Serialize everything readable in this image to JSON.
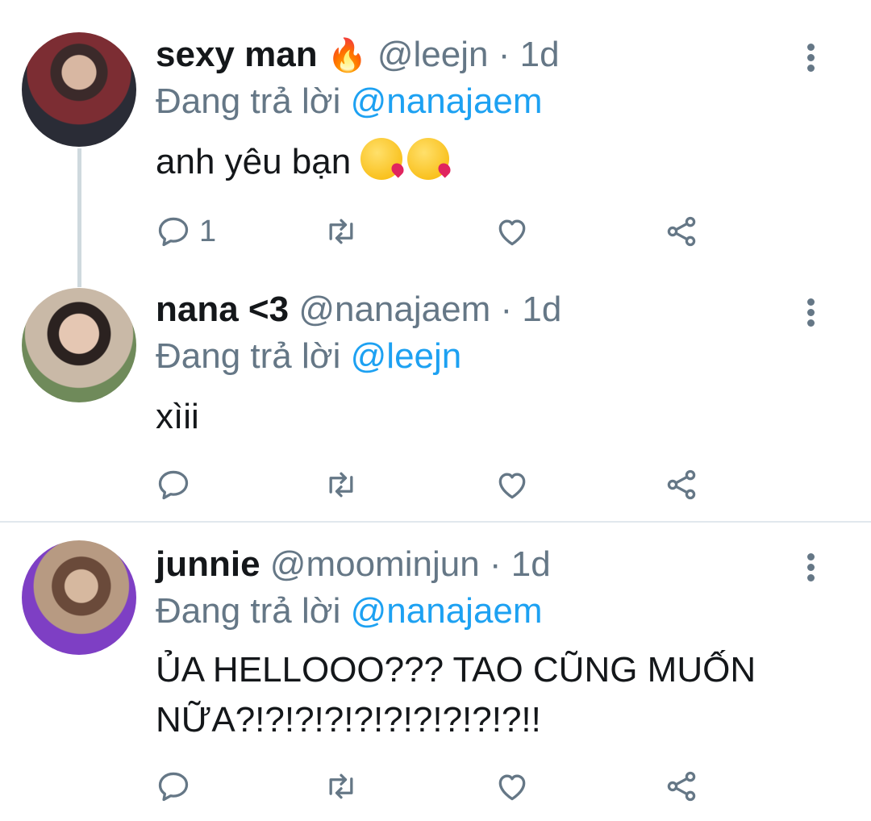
{
  "tweets": [
    {
      "name": "sexy man",
      "name_emoji": "🔥",
      "handle": "@leejn",
      "dot": "·",
      "time": "1d",
      "reply_prefix": "Đang trả lời",
      "reply_to": "@nanajaem",
      "text": "anh yêu bạn",
      "text_emojis": [
        "😘",
        "😘"
      ],
      "reply_count": "1"
    },
    {
      "name": "nana <3",
      "handle": "@nanajaem",
      "dot": "·",
      "time": "1d",
      "reply_prefix": "Đang trả lời",
      "reply_to": "@leejn",
      "text": "xìii",
      "reply_count": ""
    },
    {
      "name": "junnie",
      "handle": "@moominjun",
      "dot": "·",
      "time": "1d",
      "reply_prefix": "Đang trả lời",
      "reply_to": "@nanajaem",
      "text": "ỦA HELLOOO??? TAO CŨNG MUỐN NỮA?!?!?!?!?!?!?!?!?!?!!",
      "reply_count": ""
    }
  ],
  "colors": {
    "accent": "#1da1f2",
    "secondary_text": "#657786",
    "icon": "#657786",
    "divider": "#e1e8ed"
  },
  "icons": [
    "reply-icon",
    "retweet-icon",
    "like-icon",
    "share-icon",
    "more-options-icon"
  ]
}
